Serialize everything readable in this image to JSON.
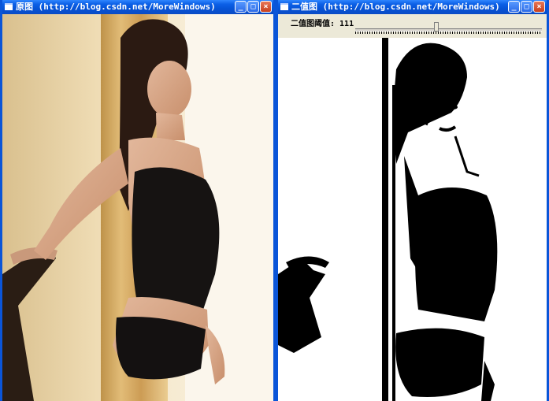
{
  "windows": {
    "original": {
      "title": "原图 (http://blog.csdn.net/MoreWindows)",
      "buttons": {
        "minimize": "_",
        "maximize": "□",
        "close": "×"
      }
    },
    "binary": {
      "title": "二值图 (http://blog.csdn.net/MoreWindows)",
      "buttons": {
        "minimize": "_",
        "maximize": "□",
        "close": "×"
      },
      "trackbar": {
        "label": "二值图阈值: 111",
        "value": 111,
        "max": 255
      }
    }
  },
  "colors": {
    "titlebar": "#0654d6",
    "frame": "#0a55d8",
    "dialog": "#ece9d8"
  },
  "icons": [
    "app-icon",
    "minimize-icon",
    "maximize-icon",
    "close-icon"
  ]
}
